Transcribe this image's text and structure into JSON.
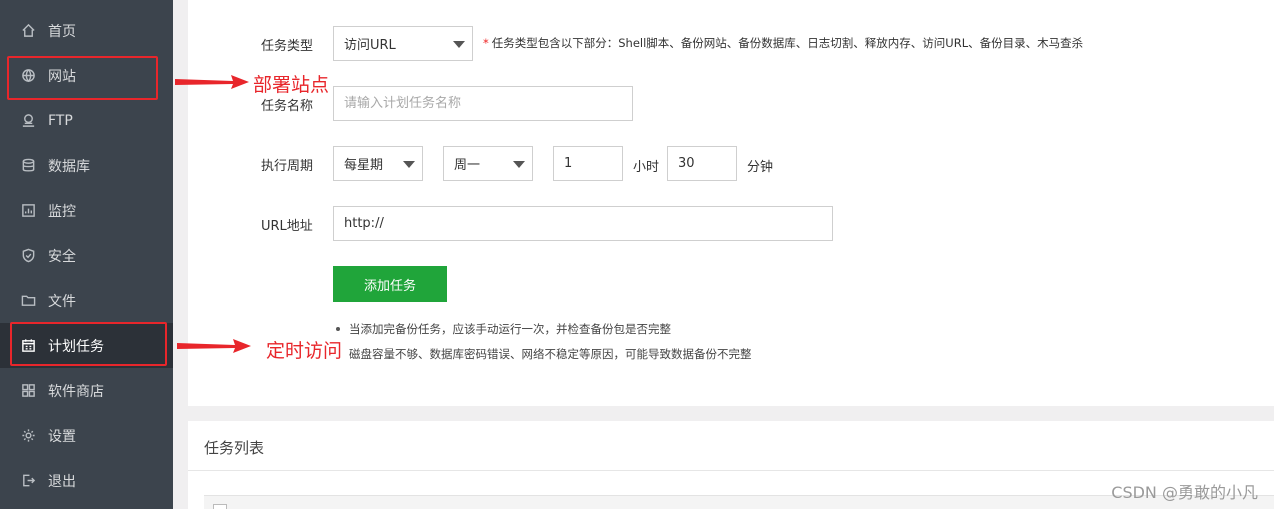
{
  "sidebar": {
    "items": [
      {
        "label": "首页",
        "icon": "home-icon"
      },
      {
        "label": "网站",
        "icon": "globe-icon"
      },
      {
        "label": "FTP",
        "icon": "ftp-icon"
      },
      {
        "label": "数据库",
        "icon": "database-icon"
      },
      {
        "label": "监控",
        "icon": "monitor-icon"
      },
      {
        "label": "安全",
        "icon": "shield-icon"
      },
      {
        "label": "文件",
        "icon": "folder-icon"
      },
      {
        "label": "计划任务",
        "icon": "calendar-icon"
      },
      {
        "label": "软件商店",
        "icon": "apps-icon"
      },
      {
        "label": "设置",
        "icon": "gear-icon"
      },
      {
        "label": "退出",
        "icon": "logout-icon"
      }
    ],
    "active_index": 7
  },
  "form": {
    "task_type_label": "任务类型",
    "task_type_value": "访问URL",
    "task_type_hint": "任务类型包含以下部分：Shell脚本、备份网站、备份数据库、日志切割、释放内存、访问URL、备份目录、木马查杀",
    "task_name_label": "任务名称",
    "task_name_placeholder": "请输入计划任务名称",
    "period_label": "执行周期",
    "period_value": "每星期",
    "weekday_value": "周一",
    "hour_value": "1",
    "hour_unit": "小时",
    "minute_value": "30",
    "minute_unit": "分钟",
    "url_label": "URL地址",
    "url_value": "http://",
    "add_button": "添加任务",
    "notes": [
      "当添加完备份任务，应该手动运行一次，并检查备份包是否完整",
      "磁盘容量不够、数据库密码错误、网络不稳定等原因，可能导致数据备份不完整"
    ]
  },
  "annotations": {
    "site_label": "部署站点",
    "cron_label": "定时访问",
    "color": "#e8262b"
  },
  "task_list": {
    "title": "任务列表"
  },
  "watermark": "CSDN @勇敢的小凡",
  "colors": {
    "sidebar_bg": "#3c444d",
    "sidebar_active": "#2c3138",
    "primary_green": "#20a53a",
    "annotation_red": "#e8262b"
  }
}
